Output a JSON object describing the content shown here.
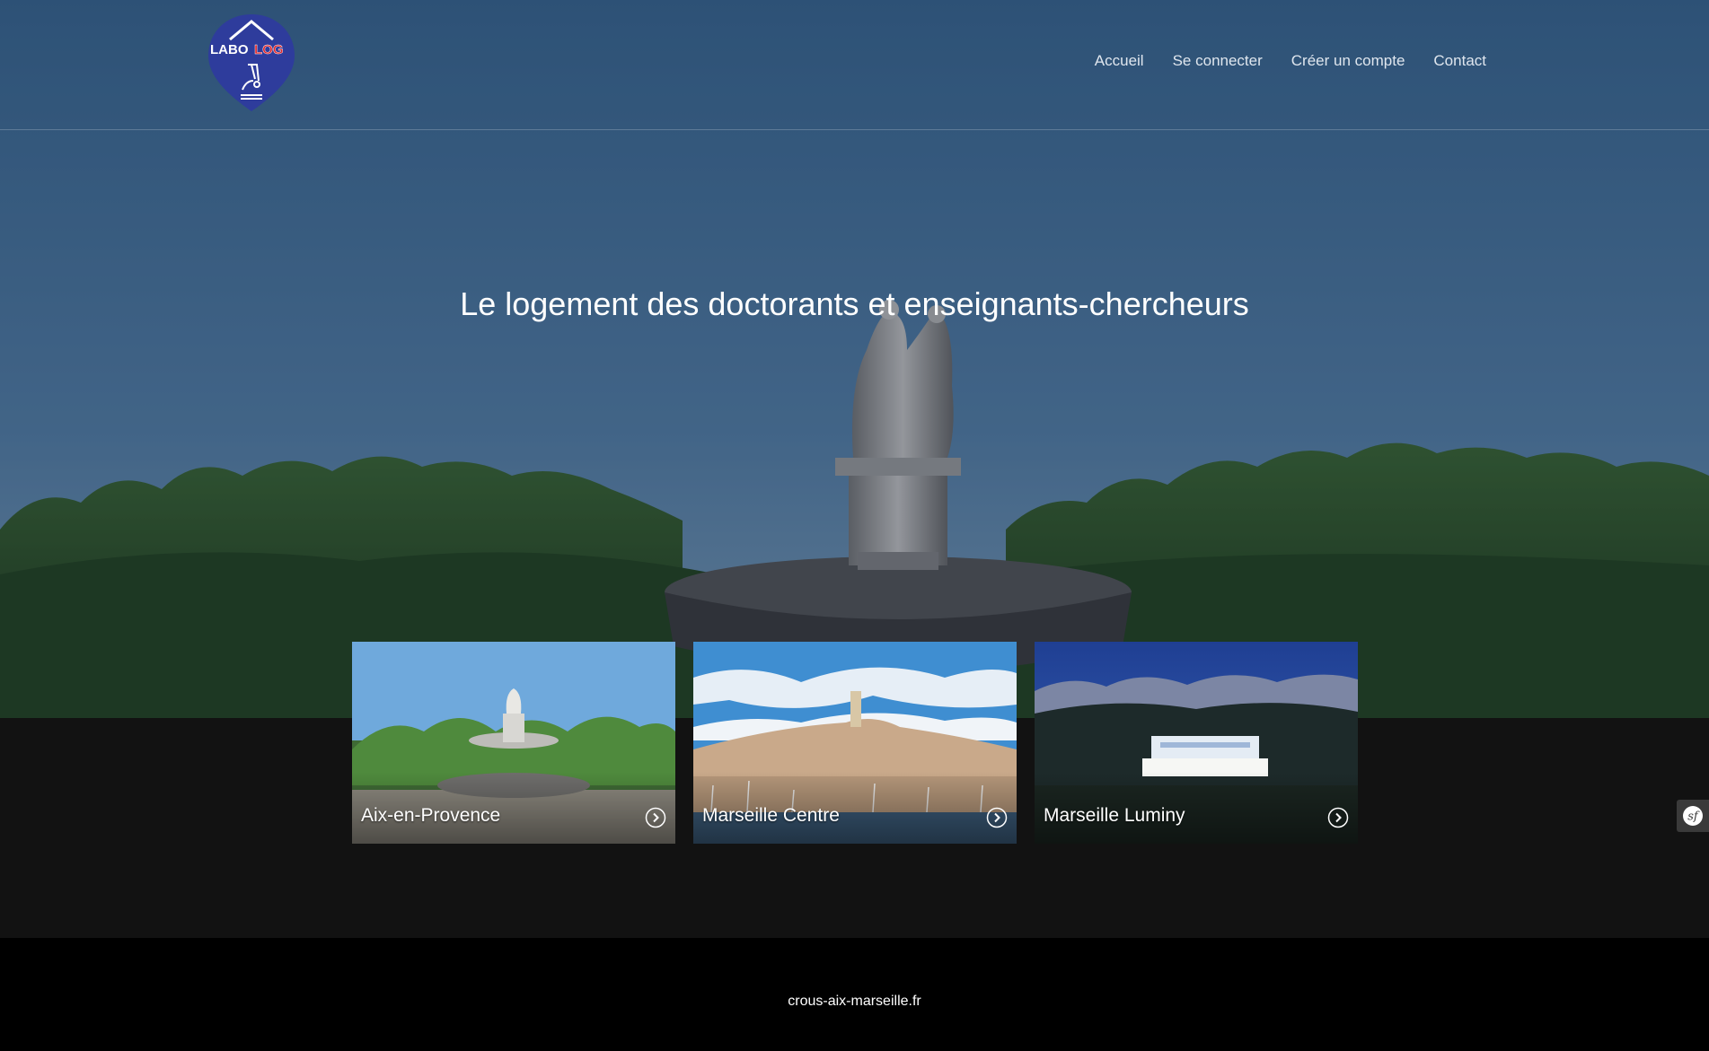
{
  "header": {
    "logo": {
      "text_left": "LABO",
      "text_right": "LOG",
      "colors": {
        "pin": "#2e3c9c",
        "accent": "#e2262a",
        "text": "#ffffff"
      }
    },
    "nav": [
      {
        "label": "Accueil"
      },
      {
        "label": "Se connecter"
      },
      {
        "label": "Créer un compte"
      },
      {
        "label": "Contact"
      }
    ]
  },
  "hero": {
    "title": "Le logement des doctorants et enseignants-chercheurs"
  },
  "cards": [
    {
      "label": "Aix-en-Provence",
      "icon": "chevron-right-circle-icon"
    },
    {
      "label": "Marseille Centre",
      "icon": "chevron-right-circle-icon"
    },
    {
      "label": "Marseille Luminy",
      "icon": "chevron-right-circle-icon"
    }
  ],
  "side_badge": {
    "icon": "symfony-icon",
    "text": "sf"
  },
  "footer": {
    "link": "crous-aix-marseille.fr"
  },
  "colors": {
    "band": "#121212",
    "footer": "#000000",
    "nav_text": "#dfe6ee"
  }
}
